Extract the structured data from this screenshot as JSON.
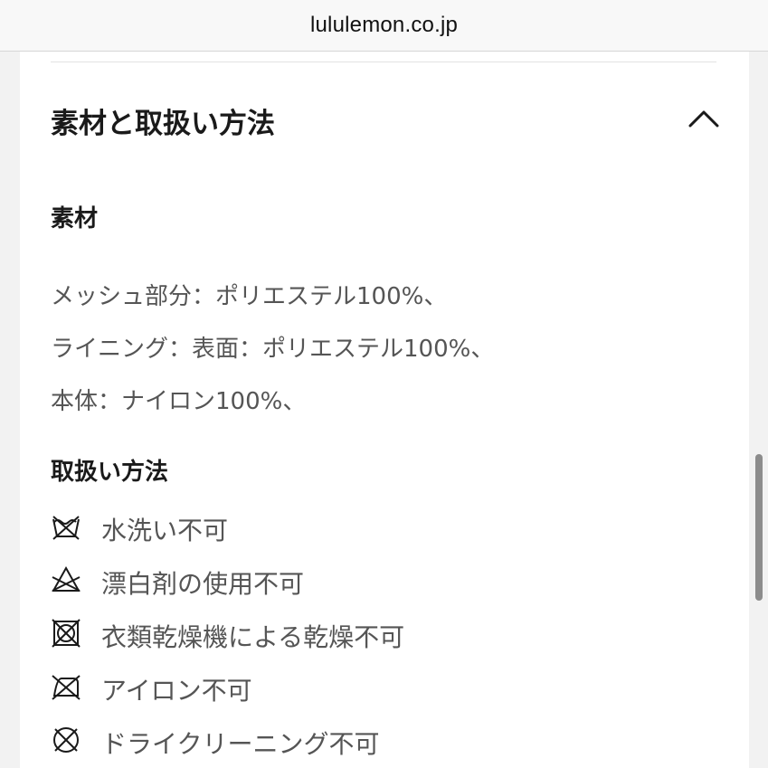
{
  "browser": {
    "url": "lululemon.co.jp"
  },
  "accordion": {
    "title": "素材と取扱い方法",
    "state_icon": "chevron-up-icon"
  },
  "materials": {
    "heading": "素材",
    "lines": [
      "メッシュ部分：ポリエステル100%、",
      "ライニング：表面：ポリエステル100%、",
      "本体：ナイロン100%、"
    ]
  },
  "care": {
    "heading": "取扱い方法",
    "items": [
      {
        "icon": "no-washing-icon",
        "label": "水洗い不可"
      },
      {
        "icon": "no-bleach-icon",
        "label": "漂白剤の使用不可"
      },
      {
        "icon": "no-tumble-dry-icon",
        "label": "衣類乾燥機による乾燥不可"
      },
      {
        "icon": "no-iron-icon",
        "label": "アイロン不可"
      },
      {
        "icon": "no-dry-clean-icon",
        "label": "ドライクリーニング不可"
      }
    ]
  },
  "colors": {
    "text_primary": "#1a1a1a",
    "text_secondary": "#555555",
    "page_bg": "#ffffff"
  }
}
